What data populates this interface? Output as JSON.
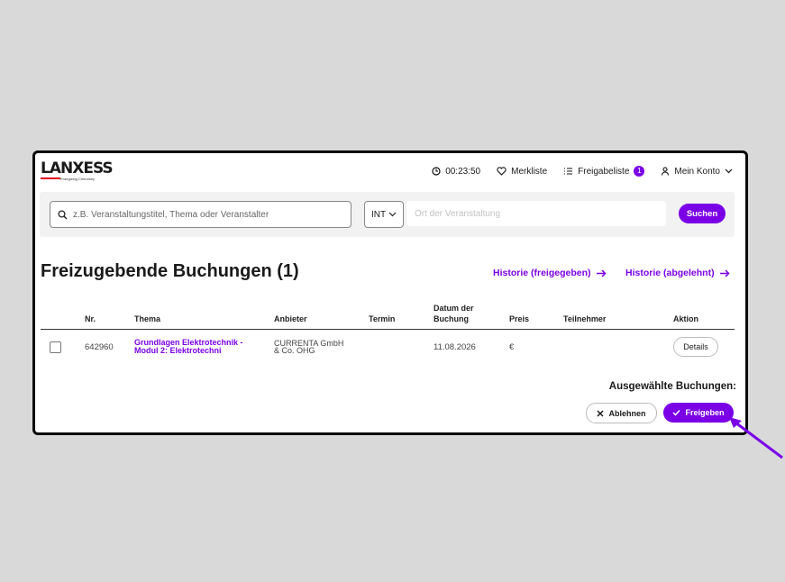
{
  "brand": {
    "logo_prefix": "LAN",
    "logo_suffix": "XESS",
    "tagline": "Energizing Chemistry"
  },
  "nav": {
    "timer": "00:23:50",
    "merkliste": "Merkliste",
    "freigabeliste": "Freigabeliste",
    "freigabe_count": "1",
    "konto": "Mein Konto"
  },
  "search": {
    "placeholder": "z.B. Veranstaltungstitel, Thema oder Veranstalter",
    "region": "INT",
    "location_placeholder": "Ort der Veranstaltung",
    "button": "Suchen"
  },
  "page": {
    "title": "Freizugebende Buchungen (1)",
    "history_approved": "Historie (freigegeben)",
    "history_rejected": "Historie (abgelehnt)"
  },
  "table": {
    "headers": {
      "nr": "Nr.",
      "thema": "Thema",
      "anbieter": "Anbieter",
      "termin": "Termin",
      "datum_line1": "Datum der",
      "datum_line2": "Buchung",
      "preis": "Preis",
      "teilnehmer": "Teilnehmer",
      "aktion": "Aktion"
    },
    "rows": [
      {
        "nr": "642960",
        "thema_line1": "Grundlagen Elektrotechnik -",
        "thema_line2": "Modul 2: Elektrotechni",
        "anbieter_line1": "CURRENTA GmbH",
        "anbieter_line2": "& Co. OHG",
        "termin": "",
        "datum": "11.08.2026",
        "preis": "€",
        "teilnehmer": "",
        "aktion": "Details"
      }
    ]
  },
  "footer": {
    "selected_label": "Ausgewählte Buchungen:",
    "reject": "Ablehnen",
    "approve": "Freigeben"
  },
  "colors": {
    "accent": "#7a00e6",
    "brand_red": "#e2001a"
  }
}
